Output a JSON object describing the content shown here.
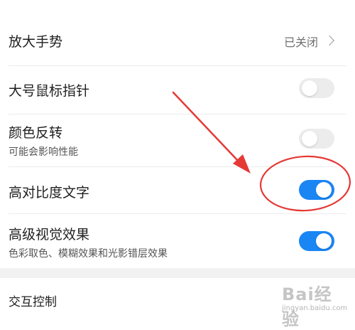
{
  "settings": [
    {
      "label": "放大手势",
      "value": "已关闭"
    },
    {
      "label": "大号鼠标指针",
      "state": "off"
    },
    {
      "label": "颜色反转",
      "description": "可能会影响性能",
      "state": "off"
    },
    {
      "label": "高对比度文字",
      "state": "on"
    },
    {
      "label": "高级视觉效果",
      "description": "色彩取色、模糊效果和光影错层效果",
      "state": "on"
    }
  ],
  "section": {
    "title": "交互控制"
  },
  "colors": {
    "accent": "#1a86f4",
    "annotation": "#e53935",
    "toggle_off": "#ececec"
  },
  "watermark": {
    "logo": "Bai经验",
    "url": "jingyan.baidu.com"
  }
}
